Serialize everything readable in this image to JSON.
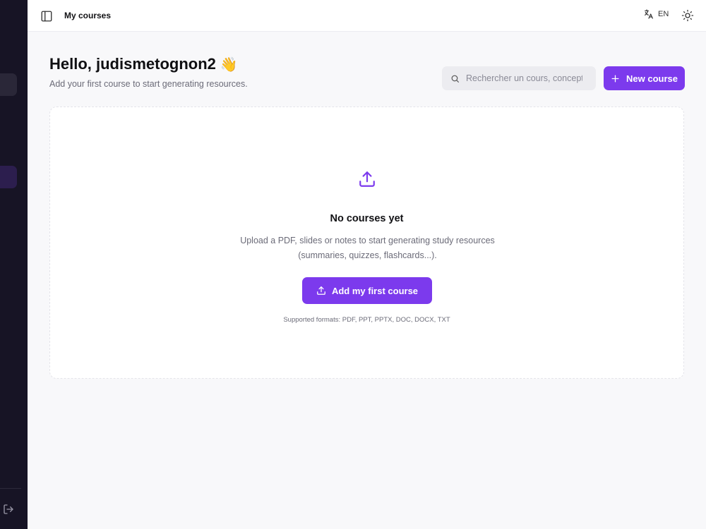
{
  "header": {
    "page_title": "My courses",
    "language": "EN"
  },
  "greeting": {
    "title": "Hello, judismetognon2",
    "emoji": "👋",
    "subtitle": "Add your first course to start generating resources."
  },
  "search": {
    "placeholder": "Rechercher un cours, concept..."
  },
  "new_course_button": {
    "label": "New course"
  },
  "empty_state": {
    "title": "No courses yet",
    "description_line1": "Upload a PDF, slides or notes to start generating study resources",
    "description_line2": "(summaries, quizzes, flashcards...).",
    "button_label": "Add my first course",
    "formats": "Supported formats: PDF, PPT, PPTX, DOC, DOCX, TXT"
  },
  "colors": {
    "accent": "#7c3aed",
    "sidebar_bg": "#171425",
    "sidebar_active": "#2c1e4e"
  },
  "icons": {
    "sidebar_toggle": "panel-left-icon",
    "language": "translate-icon",
    "theme": "sun-icon",
    "search": "search-icon",
    "add": "plus-icon",
    "upload": "upload-icon",
    "logout": "logout-icon"
  }
}
